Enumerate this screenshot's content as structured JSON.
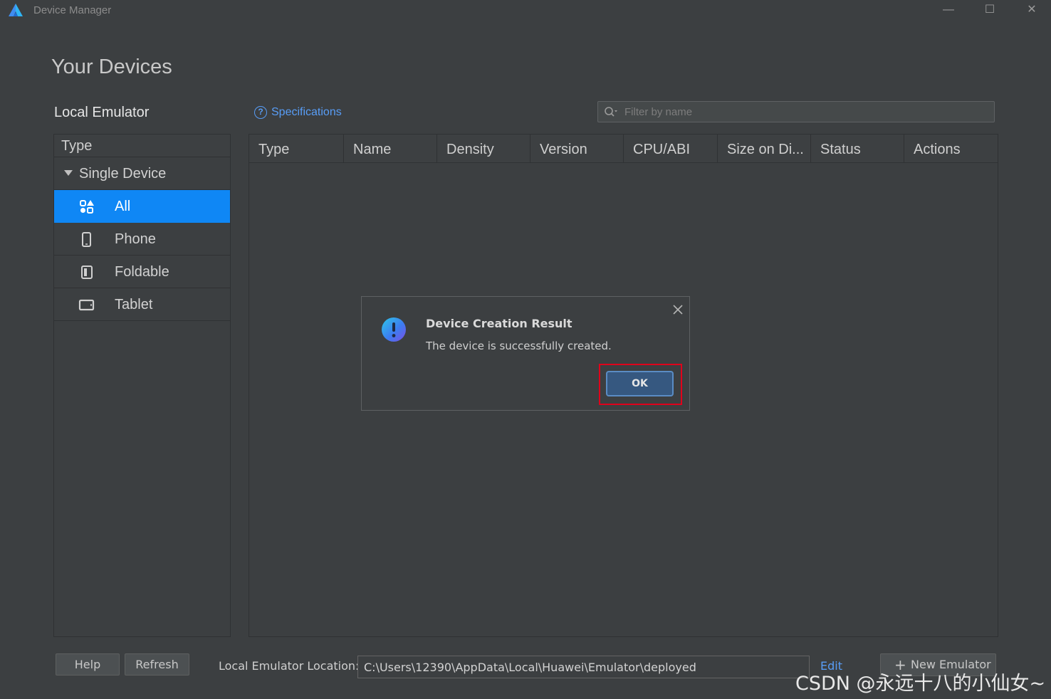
{
  "window": {
    "title": "Device Manager",
    "minimize_glyph": "—",
    "maximize_glyph": "☐",
    "close_glyph": "✕"
  },
  "page": {
    "title": "Your Devices",
    "section_title": "Local Emulator"
  },
  "sidebar": {
    "header": "Type",
    "group": "Single Device",
    "items": [
      {
        "label": "All",
        "icon": "all-devices-icon",
        "selected": true
      },
      {
        "label": "Phone",
        "icon": "phone-icon",
        "selected": false
      },
      {
        "label": "Foldable",
        "icon": "foldable-icon",
        "selected": false
      },
      {
        "label": "Tablet",
        "icon": "tablet-icon",
        "selected": false
      }
    ]
  },
  "toolbar": {
    "specifications_label": "Specifications",
    "filter_placeholder": "Filter by name"
  },
  "table": {
    "columns": [
      "Type",
      "Name",
      "Density",
      "Version",
      "CPU/ABI",
      "Size on Di...",
      "Status",
      "Actions"
    ],
    "rows": []
  },
  "dialog": {
    "title": "Device Creation Result",
    "message": "The device is successfully created.",
    "ok_label": "OK",
    "icon": "info-icon"
  },
  "footer": {
    "help_label": "Help",
    "refresh_label": "Refresh",
    "location_label": "Local Emulator Location:",
    "location_value": "C:\\Users\\12390\\AppData\\Local\\Huawei\\Emulator\\deployed",
    "edit_label": "Edit",
    "new_emulator_label": "New Emulator"
  },
  "watermark": "CSDN @永远十八的小仙女~",
  "colors": {
    "background": "#3c3f41",
    "selection": "#0f87f5",
    "link": "#589df6",
    "highlight_border": "#e0001b",
    "ok_button": "#365880"
  }
}
